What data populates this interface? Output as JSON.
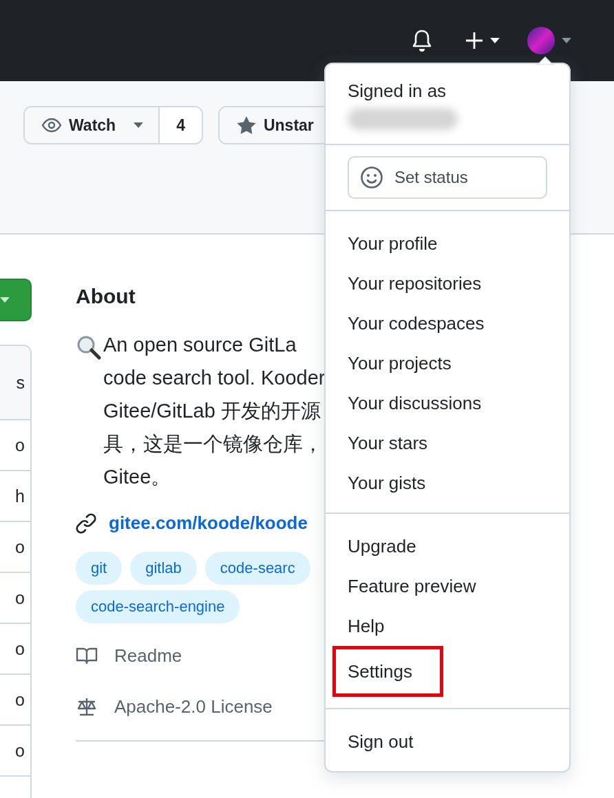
{
  "repo_actions": [
    {
      "kind": "watch",
      "label": "Watch",
      "count": "4"
    },
    {
      "kind": "star",
      "label": "Unstar"
    }
  ],
  "file_list": {
    "header": "s",
    "rows": [
      "o",
      "h",
      "o",
      "o",
      "o",
      "o",
      "o",
      ""
    ]
  },
  "about": {
    "title": "About",
    "description_lines": [
      "An open source GitLa",
      "code search tool. Kooder",
      "Gitee/GitLab 开发的开源",
      "具，这是一个镜像仓库，",
      "Gitee。"
    ],
    "link": "gitee.com/koode/koode",
    "topics": [
      "git",
      "gitlab",
      "code-searc",
      "code-search-engine"
    ],
    "meta": [
      {
        "kind": "readme",
        "label": "Readme"
      },
      {
        "kind": "license",
        "label": "Apache-2.0 License"
      }
    ]
  },
  "user_menu": {
    "signed_in_label": "Signed in as",
    "status_button": "Set status",
    "sections": [
      [
        {
          "label": "Your profile",
          "highlighted": false
        },
        {
          "label": "Your repositories",
          "highlighted": false
        },
        {
          "label": "Your codespaces",
          "highlighted": false
        },
        {
          "label": "Your projects",
          "highlighted": false
        },
        {
          "label": "Your discussions",
          "highlighted": false
        },
        {
          "label": "Your stars",
          "highlighted": false
        },
        {
          "label": "Your gists",
          "highlighted": false
        }
      ],
      [
        {
          "label": "Upgrade",
          "highlighted": false
        },
        {
          "label": "Feature preview",
          "highlighted": false
        },
        {
          "label": "Help",
          "highlighted": false
        },
        {
          "label": "Settings",
          "highlighted": true
        }
      ],
      [
        {
          "label": "Sign out",
          "highlighted": false
        }
      ]
    ]
  }
}
